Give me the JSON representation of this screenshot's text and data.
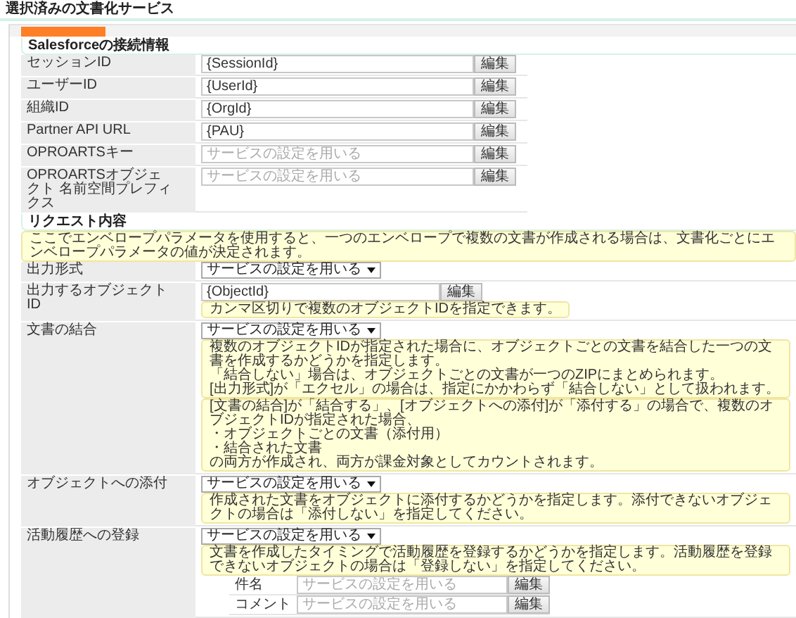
{
  "header": {
    "title": "選択済みの文書化サービス"
  },
  "sections": [
    {
      "title": "Salesforceの接続情報",
      "rows": [
        {
          "label": "セッションID",
          "kind": "input",
          "value": "{SessionId}",
          "button": "編集"
        },
        {
          "label": "ユーザーID",
          "kind": "input",
          "value": "{UserId}",
          "button": "編集"
        },
        {
          "label": "組織ID",
          "kind": "input",
          "value": "{OrgId}",
          "button": "編集"
        },
        {
          "label": "Partner API URL",
          "kind": "input",
          "value": "{PAU}",
          "button": "編集"
        },
        {
          "label": "OPROARTSキー",
          "kind": "input",
          "placeholder": "サービスの設定を用いる",
          "button": "編集"
        },
        {
          "label": "OPROARTSオブジェクト 名前空間プレフィクス",
          "kind": "input",
          "placeholder": "サービスの設定を用いる",
          "button": "編集"
        }
      ]
    },
    {
      "title": "リクエスト内容",
      "note": "ここでエンベロープパラメータを使用すると、一つのエンベロープで複数の文書が作成される場合は、文書化ごとにエンベロープパラメータの値が決定されます。",
      "rows": [
        {
          "label": "出力形式",
          "kind": "select",
          "value": "サービスの設定を用いる"
        },
        {
          "label": "出力するオブジェクトID",
          "kind": "input",
          "value": "{ObjectId}",
          "button": "編集",
          "notes": [
            [
              "カンマ区切りで複数のオブジェクトIDを指定できます。"
            ]
          ]
        },
        {
          "label": "文書の結合",
          "kind": "select",
          "value": "サービスの設定を用いる",
          "notes": [
            [
              "複数のオブジェクトIDが指定された場合に、オブジェクトごとの文書を結合した一つの文書を作成するかどうかを指定します。",
              "「結合しない」場合は、オブジェクトごとの文書が一つのZIPにまとめられます。",
              "[出力形式]が「エクセル」の場合は、指定にかかわらず「結合しない」として扱われます。"
            ],
            [
              "[文書の結合]が「結合する」、[オブジェクトへの添付]が「添付する」の場合で、複数のオブジェクトIDが指定された場合、",
              "・オブジェクトごとの文書（添付用）",
              "・結合された文書",
              "の両方が作成され、両方が課金対象としてカウントされます。"
            ]
          ]
        },
        {
          "label": "オブジェクトへの添付",
          "kind": "select",
          "value": "サービスの設定を用いる",
          "notes": [
            [
              "作成された文書をオブジェクトに添付するかどうかを指定します。添付できないオブジェクトの場合は「添付しない」を指定してください。"
            ]
          ]
        },
        {
          "label": "活動履歴への登録",
          "kind": "select",
          "value": "サービスの設定を用いる",
          "notes": [
            [
              "文書を作成したタイミングで活動履歴を登録するかどうかを指定します。活動履歴を登録できないオブジェクトの場合は「登録しない」を指定してください。"
            ]
          ],
          "subfields": [
            {
              "label": "件名",
              "placeholder": "サービスの設定を用いる",
              "button": "編集"
            },
            {
              "label": "コメント",
              "placeholder": "サービスの設定を用いる",
              "button": "編集"
            }
          ]
        }
      ]
    }
  ]
}
